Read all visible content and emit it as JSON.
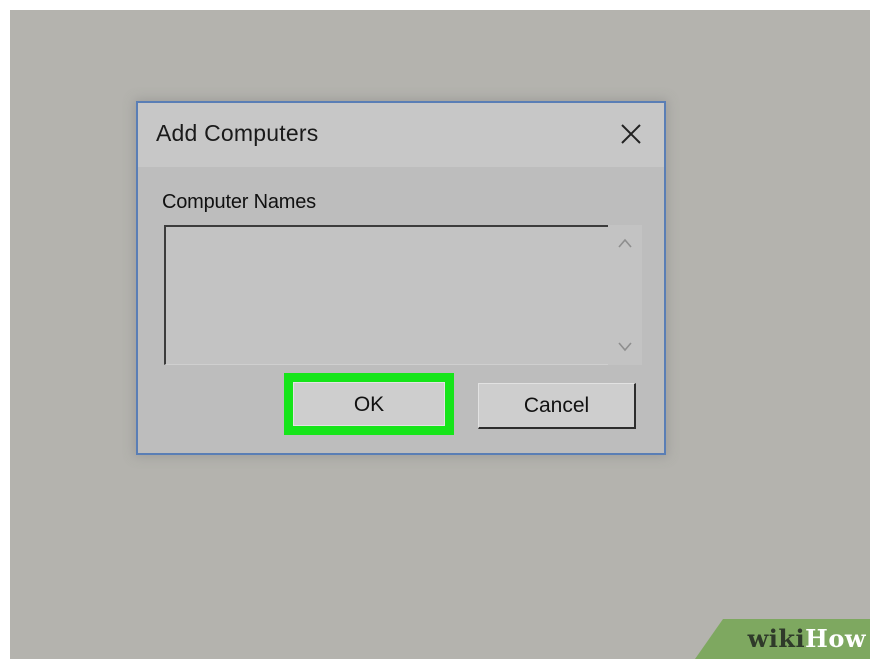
{
  "dialog": {
    "title": "Add Computers",
    "field_label": "Computer Names",
    "textarea_value": "",
    "ok_label": "OK",
    "cancel_label": "Cancel"
  },
  "icons": {
    "close": "close-icon",
    "scroll_up": "chevron-up-icon",
    "scroll_down": "chevron-down-icon"
  },
  "colors": {
    "background": "#b4b3ae",
    "dialog_border": "#5a7eb5",
    "highlight": "#16e51a",
    "watermark": "#7ea860"
  },
  "watermark": {
    "part1": "wiki",
    "part2": "How"
  }
}
